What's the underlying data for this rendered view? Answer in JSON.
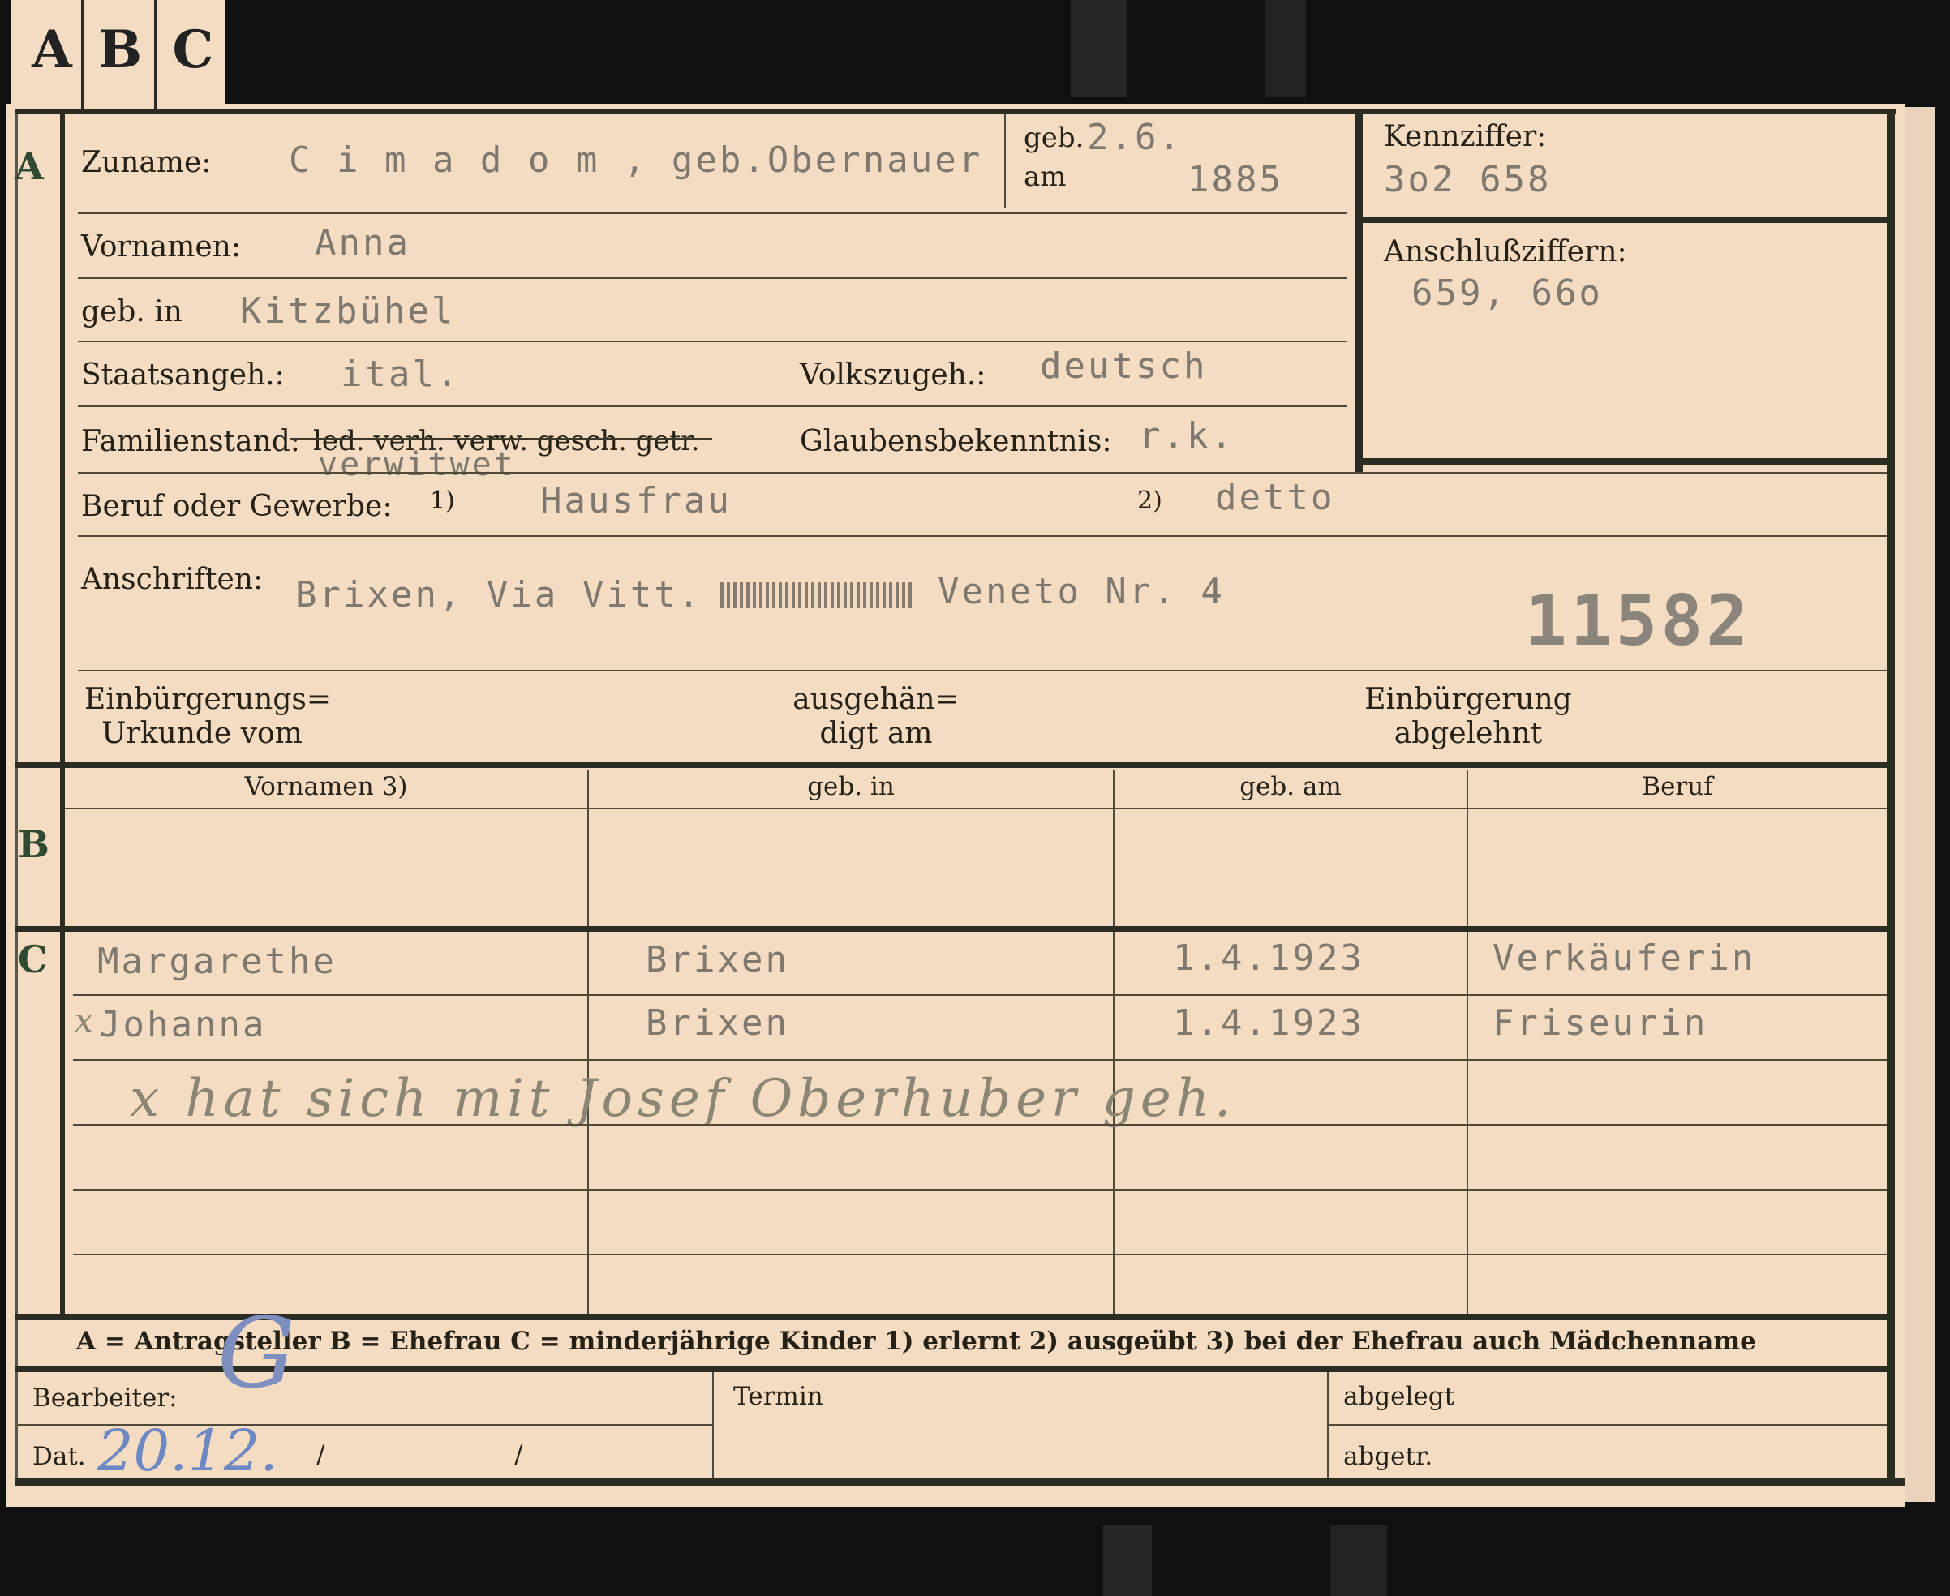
{
  "tabs": [
    "A",
    "B",
    "C"
  ],
  "section_letters": {
    "a": "A",
    "b": "B",
    "c": "C"
  },
  "section_a": {
    "zuname_label": "Zuname:",
    "zuname_value": "C i m a d o m , geb.Obernauer",
    "geb_label": "geb.",
    "am_label": "am",
    "geb_date": "2.6.",
    "geb_year": "1885",
    "kennziffer_label": "Kennziffer:",
    "kennziffer_value": "3o2 658",
    "vornamen_label": "Vornamen:",
    "vornamen_value": "Anna",
    "anschluss_label": "Anschlußziffern:",
    "anschluss_value": "659, 66o",
    "gebin_label": "geb. in",
    "gebin_value": "Kitzbühel",
    "staats_label": "Staatsangeh.:",
    "staats_value": "ital.",
    "volks_label": "Volkszugeh.:",
    "volks_value": "deutsch",
    "familien_label": "Familienstand:",
    "familien_options": "led. verh. verw. gesch. getr.",
    "familien_value": "verwitwet",
    "glaubens_label": "Glaubensbekenntnis:",
    "glaubens_value": "r.k.",
    "beruf_label": "Beruf oder Gewerbe:",
    "beruf_note1": "1)",
    "beruf_value1": "Hausfrau",
    "beruf_note2": "2)",
    "beruf_value2": "detto",
    "anschriften_label": "Anschriften:",
    "anschriften_value": "Brixen, Via Vitt.",
    "anschriften_value_end": "Veneto Nr. 4",
    "stamp_number": "11582",
    "einb_urkunde_label": "Einbürgerungs=\nUrkunde vom",
    "ausgehaendigt_label": "ausgehän=\ndigt am",
    "einb_abgelehnt_label": "Einbürgerung\nabgelehnt"
  },
  "section_b": {
    "headers": [
      "Vornamen 3)",
      "geb. in",
      "geb. am",
      "Beruf"
    ]
  },
  "section_c": {
    "rows": [
      {
        "marker": "",
        "vornamen": "Margarethe",
        "geb_in": "Brixen",
        "geb_am": "1.4.1923",
        "beruf": "Verkäuferin"
      },
      {
        "marker": "x",
        "vornamen": "Johanna",
        "geb_in": "Brixen",
        "geb_am": "1.4.1923",
        "beruf": "Friseurin"
      }
    ],
    "handwritten_note": "x hat sich mit Josef Oberhuber geh."
  },
  "legend": "A = Antragsteller   B = Ehefrau   C = minderjährige Kinder   1) erlernt   2) ausgeübt   3) bei der Ehefrau auch Mädchenname",
  "footer": {
    "bearbeiter_label": "Bearbeiter:",
    "bearbeiter_value": "G",
    "dat_label": "Dat.",
    "dat_value": "20.12.",
    "slash1": "/",
    "slash2": "/",
    "termin_label": "Termin",
    "abgelegt_label": "abgelegt",
    "abgetr_label": "abgetr."
  }
}
